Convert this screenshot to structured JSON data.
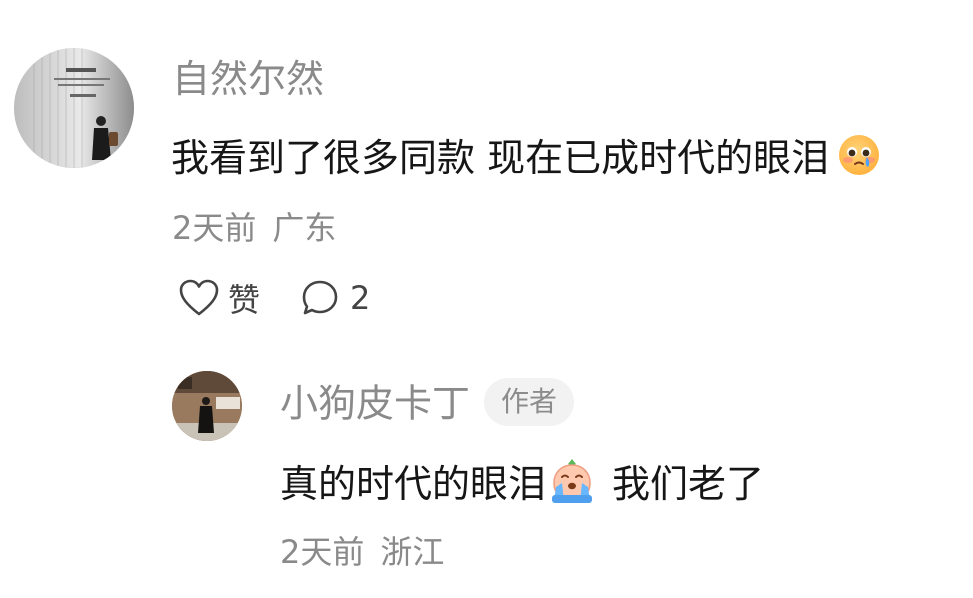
{
  "comment": {
    "username": "自然尔然",
    "text_before_emoji": "我看到了很多同款 现在已成时代的眼泪",
    "emoji_icon": "holding-back-tears-face",
    "time": "2天前",
    "location": "广东",
    "like_label": "赞",
    "reply_count": "2"
  },
  "reply": {
    "username": "小狗皮卡丁",
    "author_badge": "作者",
    "text_before_emoji": "真的时代的眼泪",
    "emoji_icon": "crying-peach-face",
    "text_after_emoji": "我们老了",
    "time": "2天前",
    "location": "浙江"
  },
  "colors": {
    "text_primary": "#161616",
    "text_secondary": "#8a8a8a",
    "badge_bg": "#f2f2f2"
  }
}
